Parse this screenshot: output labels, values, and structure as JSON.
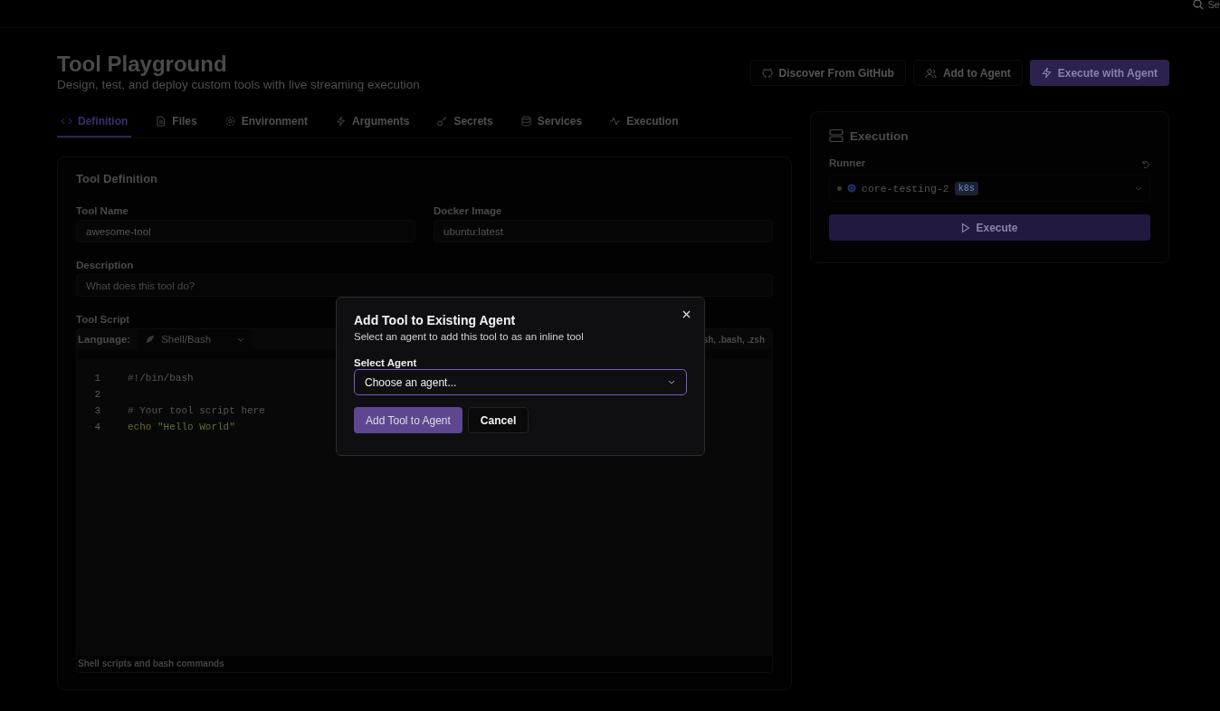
{
  "top_bar": {
    "search_text": "Se"
  },
  "header": {
    "title": "Tool Playground",
    "subtitle": "Design, test, and deploy custom tools with live streaming execution",
    "actions": [
      {
        "label": "Discover From GitHub",
        "kind": "outline"
      },
      {
        "label": "Add to Agent",
        "kind": "outline"
      },
      {
        "label": "Execute with Agent",
        "kind": "primary"
      }
    ]
  },
  "tabs": [
    {
      "label": "Definition",
      "selected": true
    },
    {
      "label": "Files",
      "selected": false
    },
    {
      "label": "Environment",
      "selected": false
    },
    {
      "label": "Arguments",
      "selected": false
    },
    {
      "label": "Secrets",
      "selected": false
    },
    {
      "label": "Services",
      "selected": false
    },
    {
      "label": "Execution",
      "selected": false
    }
  ],
  "definition": {
    "title": "Tool Definition",
    "tool_name": {
      "label": "Tool Name",
      "value": "awesome-tool"
    },
    "docker_image": {
      "label": "Docker Image",
      "value": "ubuntu:latest"
    },
    "description": {
      "label": "Description",
      "placeholder": "What does this tool do?"
    },
    "script": {
      "label": "Tool Script",
      "language_label": "Language:",
      "language": "Shell/Bash",
      "extensions": "sh, .bash, .zsh",
      "lines": [
        {
          "number": "1",
          "tokens": [
            {
              "text": "#!/bin/bash",
              "kind": "comment"
            }
          ]
        },
        {
          "number": "2"
        },
        {
          "number": "3",
          "tokens": [
            {
              "text": "# Your tool script here",
              "kind": "comment"
            }
          ]
        },
        {
          "number": "4",
          "tokens": [
            {
              "text": "echo",
              "kind": "keyword"
            },
            {
              "text": "\"Hello World\"",
              "kind": "string"
            }
          ]
        }
      ],
      "footer": "Shell scripts and bash commands"
    }
  },
  "execution": {
    "title": "Execution",
    "runner_label": "Runner",
    "runner": {
      "name": "core-testing-2",
      "badge": "k8s",
      "online": true
    },
    "button": "Execute"
  },
  "dialog": {
    "title": "Add Tool to Existing Agent",
    "subtitle": "Select an agent to add this tool to as an inline tool",
    "field_label": "Select Agent",
    "placeholder": "Choose an agent...",
    "confirm": "Add Tool to Agent",
    "cancel": "Cancel"
  }
}
